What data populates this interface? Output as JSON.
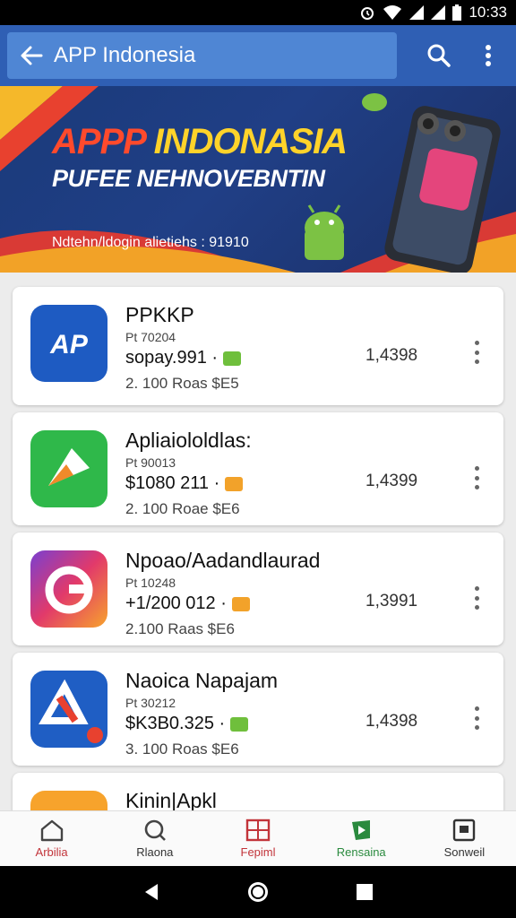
{
  "status_bar": {
    "time": "10:33"
  },
  "header": {
    "title": "APP Indonesia"
  },
  "banner": {
    "title_part1": "APPP",
    "title_part2": "INDONASIA",
    "subtitle": "PUFEE NEHNOVEBNTIN",
    "tagline": "Ndtehn/ldogin alietiehs : 91910"
  },
  "apps": [
    {
      "name": "PPKKP",
      "sub": "Pt 70204",
      "price": "sopay.991 ·",
      "badge_color": "#6fbf3c",
      "meta": "2. 100   Roas   $E5",
      "count": "1,4398"
    },
    {
      "name": "Apliaiololdlas:",
      "sub": "Pt 90013",
      "price": "$1080 211 ·",
      "badge_color": "#f2a22a",
      "meta": "2. 100   Roae   $E6",
      "count": "1,4399"
    },
    {
      "name": "Npoao/Aadandlaurad",
      "sub": "Pt 10248",
      "price": "+1/200 012 ·",
      "badge_color": "#f2a22a",
      "meta": "2.100   Raas   $E6",
      "count": "1,3991"
    },
    {
      "name": "Naoica Napajam",
      "sub": "Pt 30212",
      "price": "$K3B0.325 ·",
      "badge_color": "#6fbf3c",
      "meta": "3. 100   Roas   $E6",
      "count": "1,4398"
    },
    {
      "name": "Kinin|Apkl",
      "sub": "",
      "price": "",
      "badge_color": "#f2a22a",
      "meta": "",
      "count": ""
    }
  ],
  "nav": [
    {
      "label": "Arbilia",
      "icon": "home-icon",
      "color": "#c2343a"
    },
    {
      "label": "Rlaona",
      "icon": "search-icon",
      "color": "#333333"
    },
    {
      "label": "Fepiml",
      "icon": "grid-icon",
      "color": "#c2343a"
    },
    {
      "label": "Rensaina",
      "icon": "play-icon",
      "color": "#2a8a3e"
    },
    {
      "label": "Sonweil",
      "icon": "account-icon",
      "color": "#333333"
    }
  ]
}
